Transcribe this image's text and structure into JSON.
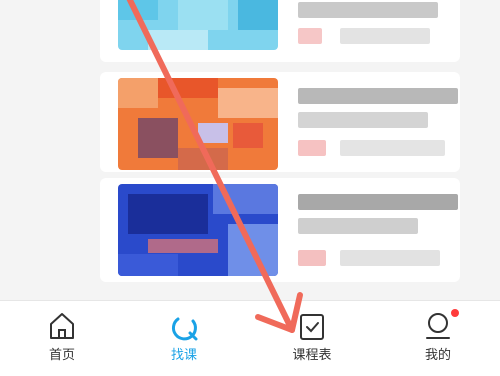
{
  "tabbar": {
    "tabs": [
      {
        "label": "首页",
        "icon": "home-icon",
        "active": false
      },
      {
        "label": "找课",
        "icon": "search-course-icon",
        "active": true
      },
      {
        "label": "课程表",
        "icon": "schedule-icon",
        "active": false
      },
      {
        "label": "我的",
        "icon": "profile-icon",
        "active": false,
        "badge": true
      }
    ],
    "active_color": "#1aa2e6",
    "badge_color": "#ff3b3b"
  },
  "annotation": {
    "icon": "arrow-annotation",
    "color": "#f06a5a"
  }
}
